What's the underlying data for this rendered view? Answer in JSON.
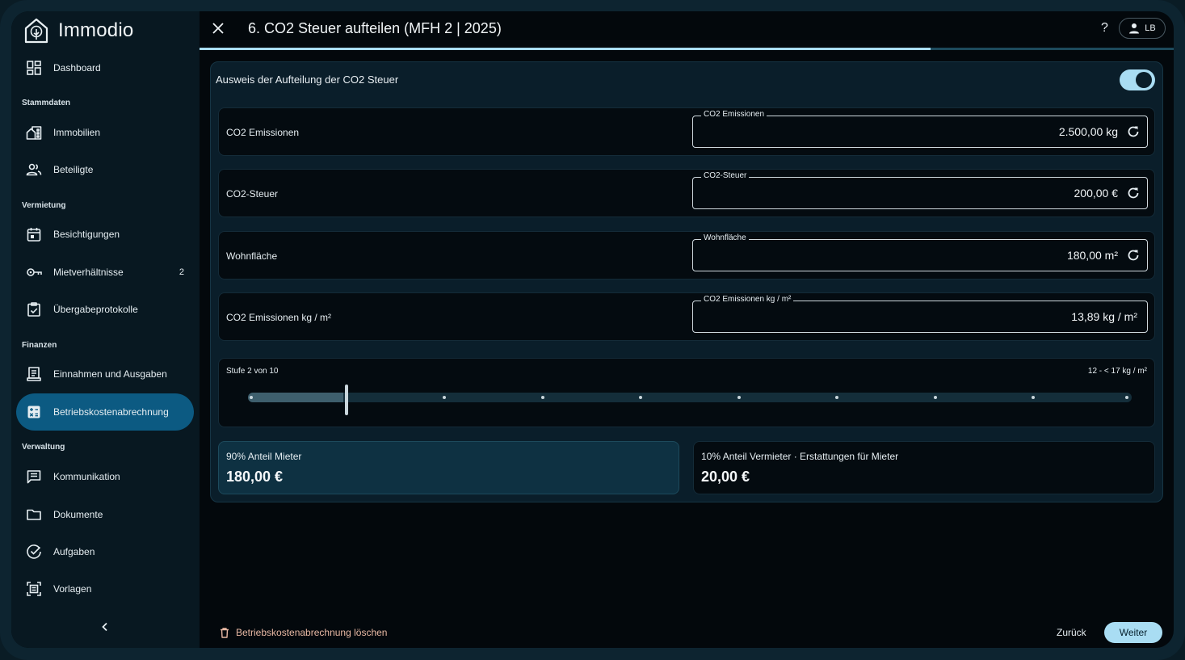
{
  "app": {
    "name": "Immodio",
    "logo_icon": "house-tree-logo-icon"
  },
  "sidebar": {
    "items": [
      {
        "label": "Dashboard",
        "icon": "dashboard-icon"
      },
      {
        "label": "Immobilien",
        "icon": "buildings-icon"
      },
      {
        "label": "Beteiligte",
        "icon": "people-icon"
      },
      {
        "label": "Besichtigungen",
        "icon": "calendar-icon"
      },
      {
        "label": "Mietverhältnisse",
        "icon": "key-icon",
        "badge": "2"
      },
      {
        "label": "Übergabeprotokolle",
        "icon": "checklist-icon"
      },
      {
        "label": "Einnahmen und Ausgaben",
        "icon": "receipt-icon"
      },
      {
        "label": "Betriebskostenabrechnung",
        "icon": "calculator-icon",
        "active": true
      },
      {
        "label": "Kommunikation",
        "icon": "chat-icon"
      },
      {
        "label": "Dokumente",
        "icon": "folder-icon"
      },
      {
        "label": "Aufgaben",
        "icon": "check-circle-icon"
      },
      {
        "label": "Vorlagen",
        "icon": "template-icon"
      }
    ],
    "sections": [
      "Stammdaten",
      "Vermietung",
      "Finanzen",
      "Verwaltung"
    ],
    "collapse_icon": "chevron-left-icon"
  },
  "header": {
    "title": "6. CO2 Steuer aufteilen (MFH 2 | 2025)",
    "help": "?",
    "user_initials": "LB",
    "progress": 0.75
  },
  "card": {
    "heading": "Ausweis der Aufteilung der CO2 Steuer",
    "toggle_on": true,
    "rows": [
      {
        "label": "CO2 Emissionen",
        "legend": "CO2 Emissionen",
        "value": "2.500,00 kg"
      },
      {
        "label": "CO2-Steuer",
        "legend": "CO2-Steuer",
        "value": "200,00 €"
      },
      {
        "label": "Wohnfläche",
        "legend": "Wohnfläche",
        "value": "180,00 m²"
      },
      {
        "label": "CO2 Emissionen kg / m²",
        "legend": "CO2 Emissionen kg / m²",
        "value": "13,89 kg / m²"
      }
    ],
    "slider": {
      "label": "Stufe 2 von 10",
      "range": "12 - < 17 kg / m²",
      "step": 2,
      "max": 10
    },
    "tenant_share": {
      "label": "90% Anteil Mieter",
      "value": "180,00 €"
    },
    "landlord_share": {
      "label": "10% Anteil Vermieter · Erstattungen für Mieter",
      "value": "20,00 €"
    }
  },
  "footer": {
    "delete_label": "Betriebskostenabrechnung löschen",
    "back_label": "Zurück",
    "next_label": "Weiter"
  },
  "colors": {
    "accent": "#a9ddf3",
    "active_nav": "#0c5a82",
    "danger_text": "#e9b9a4"
  }
}
